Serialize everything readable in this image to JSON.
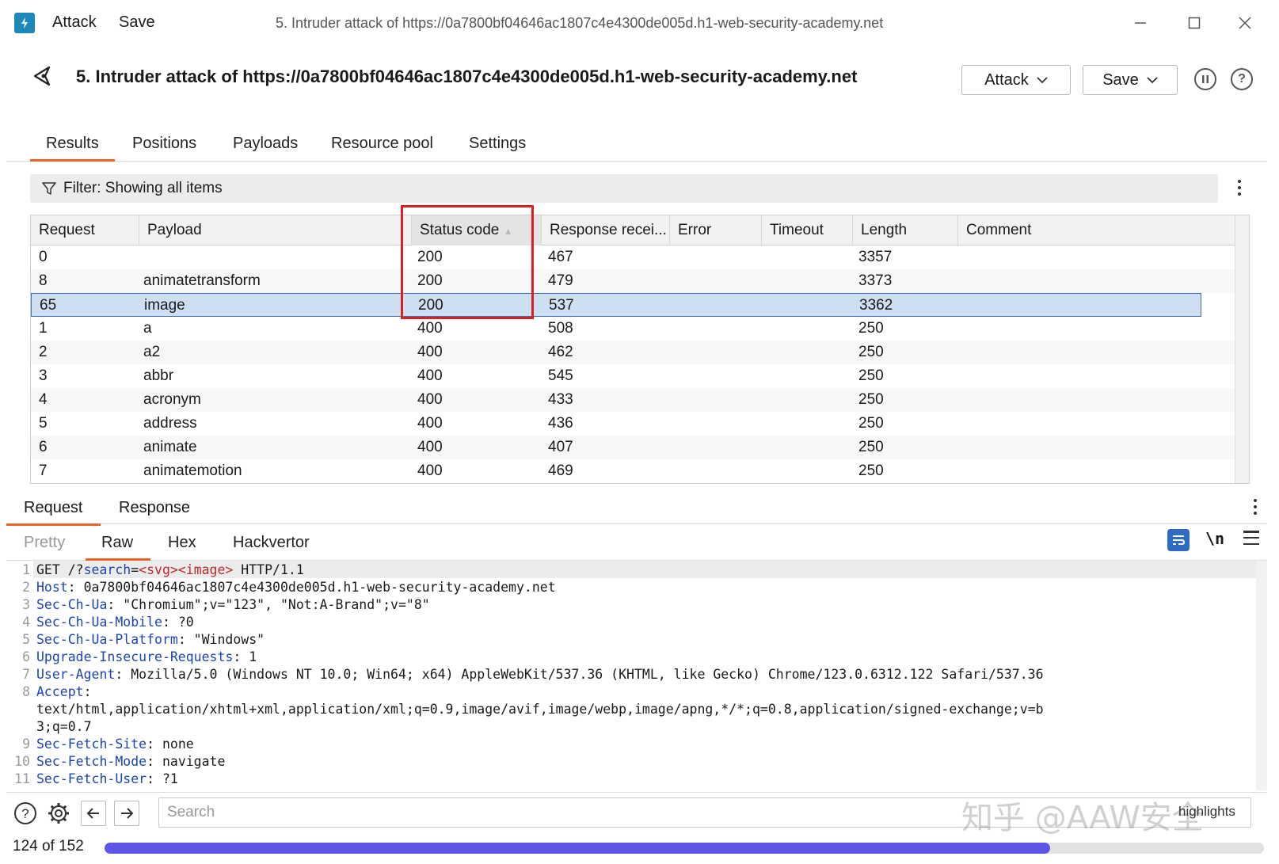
{
  "window": {
    "menu_attack": "Attack",
    "menu_save": "Save",
    "title": "5. Intruder attack of https://0a7800bf04646ac1807c4e4300de005d.h1-web-security-academy.net"
  },
  "header": {
    "title": "5. Intruder attack of https://0a7800bf04646ac1807c4e4300de005d.h1-web-security-academy.net",
    "attack_btn": "Attack",
    "save_btn": "Save"
  },
  "tabs": [
    "Results",
    "Positions",
    "Payloads",
    "Resource pool",
    "Settings"
  ],
  "filter": {
    "label": "Filter: Showing all items"
  },
  "table": {
    "columns": [
      "Request",
      "Payload",
      "Status code",
      "Response recei...",
      "Error",
      "Timeout",
      "Length",
      "Comment"
    ],
    "rows": [
      {
        "request": "0",
        "payload": "",
        "status": "200",
        "response": "467",
        "length": "3357"
      },
      {
        "request": "8",
        "payload": "animatetransform",
        "status": "200",
        "response": "479",
        "length": "3373"
      },
      {
        "request": "65",
        "payload": "image",
        "status": "200",
        "response": "537",
        "length": "3362"
      },
      {
        "request": "1",
        "payload": "a",
        "status": "400",
        "response": "508",
        "length": "250"
      },
      {
        "request": "2",
        "payload": "a2",
        "status": "400",
        "response": "462",
        "length": "250"
      },
      {
        "request": "3",
        "payload": "abbr",
        "status": "400",
        "response": "545",
        "length": "250"
      },
      {
        "request": "4",
        "payload": "acronym",
        "status": "400",
        "response": "433",
        "length": "250"
      },
      {
        "request": "5",
        "payload": "address",
        "status": "400",
        "response": "436",
        "length": "250"
      },
      {
        "request": "6",
        "payload": "animate",
        "status": "400",
        "response": "407",
        "length": "250"
      },
      {
        "request": "7",
        "payload": "animatemotion",
        "status": "400",
        "response": "469",
        "length": "250"
      }
    ]
  },
  "lower_tabs": [
    "Request",
    "Response"
  ],
  "view_tabs": [
    "Pretty",
    "Raw",
    "Hex",
    "Hackvertor"
  ],
  "editor": {
    "line_numbers": [
      "1",
      "2",
      "3",
      "4",
      "5",
      "6",
      "7",
      "8",
      "",
      "",
      "9",
      "10",
      "11"
    ],
    "l1_method": "GET /?",
    "l1_param": "search",
    "l1_eq": "=",
    "l1_value": "<svg><image>",
    "l1_proto": " HTTP/1.1",
    "headers": [
      {
        "name": "Host",
        "value": ": 0a7800bf04646ac1807c4e4300de005d.h1-web-security-academy.net"
      },
      {
        "name": "Sec-Ch-Ua",
        "value": ": \"Chromium\";v=\"123\", \"Not:A-Brand\";v=\"8\""
      },
      {
        "name": "Sec-Ch-Ua-Mobile",
        "value": ": ?0"
      },
      {
        "name": "Sec-Ch-Ua-Platform",
        "value": ": \"Windows\""
      },
      {
        "name": "Upgrade-Insecure-Requests",
        "value": ": 1"
      },
      {
        "name": "User-Agent",
        "value": ": Mozilla/5.0 (Windows NT 10.0; Win64; x64) AppleWebKit/537.36 (KHTML, like Gecko) Chrome/123.0.6312.122 Safari/537.36"
      },
      {
        "name": "Accept",
        "value": ":"
      },
      {
        "name": "",
        "value": "text/html,application/xhtml+xml,application/xml;q=0.9,image/avif,image/webp,image/apng,*/*;q=0.8,application/signed-exchange;v=b"
      },
      {
        "name": "",
        "value": "3;q=0.7"
      },
      {
        "name": "Sec-Fetch-Site",
        "value": ": none"
      },
      {
        "name": "Sec-Fetch-Mode",
        "value": ": navigate"
      },
      {
        "name": "Sec-Fetch-User",
        "value": ": ?1"
      }
    ]
  },
  "search": {
    "placeholder": "Search",
    "highlights": "highlights"
  },
  "progress": {
    "label": "124 of 152",
    "fraction": 0.8158
  },
  "watermark": "知乎 @AAW安全",
  "colors": {
    "accent": "#e8642a",
    "selection": "#cfdff2",
    "progress": "#5b56e8",
    "highlight_box": "#d92020",
    "header_name": "#1b45b0",
    "payload_value": "#c0282a"
  }
}
